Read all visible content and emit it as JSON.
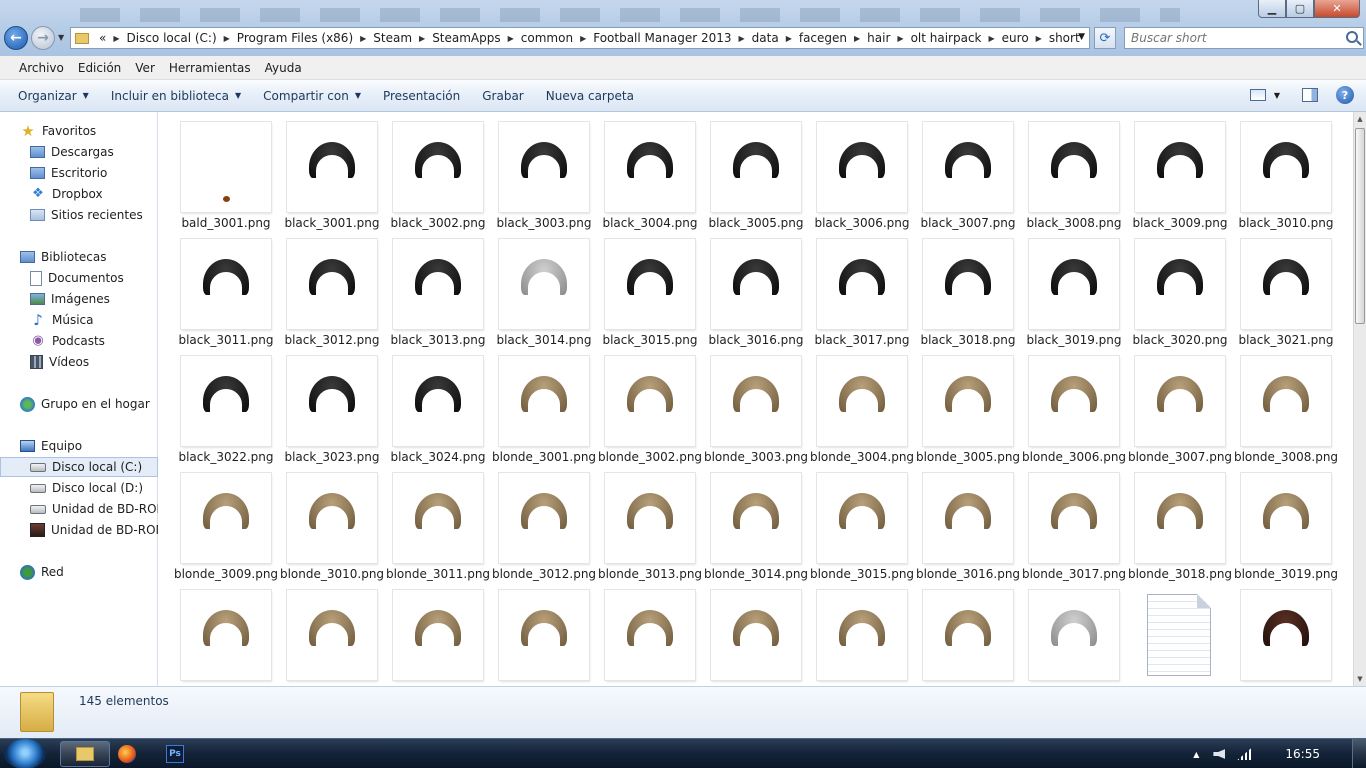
{
  "window": {
    "min_label": "▁",
    "max_label": "▢",
    "close_label": "✕"
  },
  "address": {
    "chevron": "«",
    "crumbs": [
      "Disco local (C:)",
      "Program Files (x86)",
      "Steam",
      "SteamApps",
      "common",
      "Football Manager 2013",
      "data",
      "facegen",
      "hair",
      "olt hairpack",
      "euro",
      "short"
    ],
    "search_placeholder": "Buscar short"
  },
  "menu": [
    "Archivo",
    "Edición",
    "Ver",
    "Herramientas",
    "Ayuda"
  ],
  "commands": {
    "organize": "Organizar",
    "library": "Incluir en biblioteca",
    "share": "Compartir con",
    "slideshow": "Presentación",
    "burn": "Grabar",
    "new_folder": "Nueva carpeta",
    "help": "?"
  },
  "nav": {
    "favorites": "Favoritos",
    "downloads": "Descargas",
    "desktop": "Escritorio",
    "dropbox": "Dropbox",
    "recent": "Sitios recientes",
    "libraries": "Bibliotecas",
    "documents": "Documentos",
    "images": "Imágenes",
    "music": "Música",
    "podcasts": "Podcasts",
    "videos": "Vídeos",
    "homegroup": "Grupo en el hogar",
    "computer": "Equipo",
    "drive_c": "Disco local (C:)",
    "drive_d": "Disco local (D:)",
    "bd1": "Unidad de BD-ROM",
    "bd2": "Unidad de BD-ROM",
    "network": "Red"
  },
  "files": [
    {
      "name": "bald_3001.png",
      "color": "bald"
    },
    {
      "name": "black_3001.png",
      "color": "black"
    },
    {
      "name": "black_3002.png",
      "color": "black"
    },
    {
      "name": "black_3003.png",
      "color": "black"
    },
    {
      "name": "black_3004.png",
      "color": "black"
    },
    {
      "name": "black_3005.png",
      "color": "black"
    },
    {
      "name": "black_3006.png",
      "color": "black"
    },
    {
      "name": "black_3007.png",
      "color": "black"
    },
    {
      "name": "black_3008.png",
      "color": "black"
    },
    {
      "name": "black_3009.png",
      "color": "black"
    },
    {
      "name": "black_3010.png",
      "color": "black"
    },
    {
      "name": "black_3011.png",
      "color": "black"
    },
    {
      "name": "black_3012.png",
      "color": "black"
    },
    {
      "name": "black_3013.png",
      "color": "black"
    },
    {
      "name": "black_3014.png",
      "color": "grey"
    },
    {
      "name": "black_3015.png",
      "color": "black"
    },
    {
      "name": "black_3016.png",
      "color": "black"
    },
    {
      "name": "black_3017.png",
      "color": "black"
    },
    {
      "name": "black_3018.png",
      "color": "black"
    },
    {
      "name": "black_3019.png",
      "color": "black"
    },
    {
      "name": "black_3020.png",
      "color": "black"
    },
    {
      "name": "black_3021.png",
      "color": "black"
    },
    {
      "name": "black_3022.png",
      "color": "black"
    },
    {
      "name": "black_3023.png",
      "color": "black"
    },
    {
      "name": "black_3024.png",
      "color": "black"
    },
    {
      "name": "blonde_3001.png",
      "color": "blonde"
    },
    {
      "name": "blonde_3002.png",
      "color": "blonde"
    },
    {
      "name": "blonde_3003.png",
      "color": "blonde"
    },
    {
      "name": "blonde_3004.png",
      "color": "blonde"
    },
    {
      "name": "blonde_3005.png",
      "color": "blonde"
    },
    {
      "name": "blonde_3006.png",
      "color": "blonde"
    },
    {
      "name": "blonde_3007.png",
      "color": "blonde"
    },
    {
      "name": "blonde_3008.png",
      "color": "blonde"
    },
    {
      "name": "blonde_3009.png",
      "color": "blonde"
    },
    {
      "name": "blonde_3010.png",
      "color": "blonde"
    },
    {
      "name": "blonde_3011.png",
      "color": "blonde"
    },
    {
      "name": "blonde_3012.png",
      "color": "blonde"
    },
    {
      "name": "blonde_3013.png",
      "color": "blonde"
    },
    {
      "name": "blonde_3014.png",
      "color": "blonde"
    },
    {
      "name": "blonde_3015.png",
      "color": "blonde"
    },
    {
      "name": "blonde_3016.png",
      "color": "blonde"
    },
    {
      "name": "blonde_3017.png",
      "color": "blonde"
    },
    {
      "name": "blonde_3018.png",
      "color": "blonde"
    },
    {
      "name": "blonde_3019.png",
      "color": "blonde"
    },
    {
      "name": "",
      "color": "blonde"
    },
    {
      "name": "",
      "color": "blonde"
    },
    {
      "name": "",
      "color": "blonde"
    },
    {
      "name": "",
      "color": "blonde"
    },
    {
      "name": "",
      "color": "blonde"
    },
    {
      "name": "",
      "color": "blonde"
    },
    {
      "name": "",
      "color": "blonde"
    },
    {
      "name": "",
      "color": "blonde"
    },
    {
      "name": "",
      "color": "grey"
    },
    {
      "name": "",
      "color": "file"
    },
    {
      "name": "",
      "color": "dark"
    }
  ],
  "status": {
    "count": "145 elementos"
  },
  "taskbar": {
    "ps_label": "Ps",
    "clock": "16:55"
  }
}
